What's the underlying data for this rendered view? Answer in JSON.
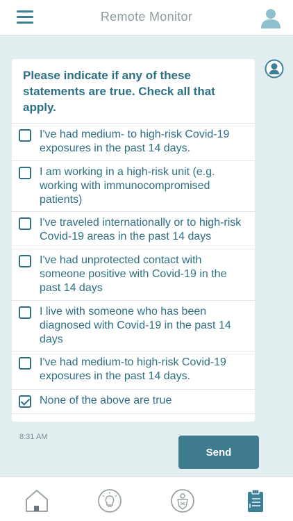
{
  "header": {
    "title": "Remote Monitor",
    "menu_icon": "hamburger-menu-icon",
    "profile_icon": "user-profile-icon"
  },
  "chat": {
    "avatar_icon": "user-avatar-icon",
    "question": "Please indicate if any of these statements are true. Check all that apply.",
    "options": [
      {
        "label": "I've had medium- to high-risk Covid-19 exposures in the past 14 days.",
        "checked": false
      },
      {
        "label": "I am working in a high-risk unit (e.g. working with immunocompromised patients)",
        "checked": false
      },
      {
        "label": "I've traveled internationally or to high-risk Covid-19 areas in the past 14 days",
        "checked": false
      },
      {
        "label": "I've had unprotected contact with someone positive with Covid-19 in the past 14 days",
        "checked": false
      },
      {
        "label": "I live with someone who has been diagnosed with Covid-19 in the past 14 days",
        "checked": false
      },
      {
        "label": "I've had medium-to high-risk Covid-19 exposures in the past 14 days.",
        "checked": false
      },
      {
        "label": "None of the above are true",
        "checked": true
      }
    ],
    "timestamp": "8:31 AM",
    "send_label": "Send"
  },
  "tabbar": {
    "tabs": [
      {
        "icon": "home-icon"
      },
      {
        "icon": "lightbulb-icon"
      },
      {
        "icon": "health-shield-icon"
      },
      {
        "icon": "clipboard-icon",
        "active": true
      }
    ]
  },
  "colors": {
    "accent": "#2f6f84",
    "button": "#3f7b8f",
    "background": "#e3eef1"
  }
}
